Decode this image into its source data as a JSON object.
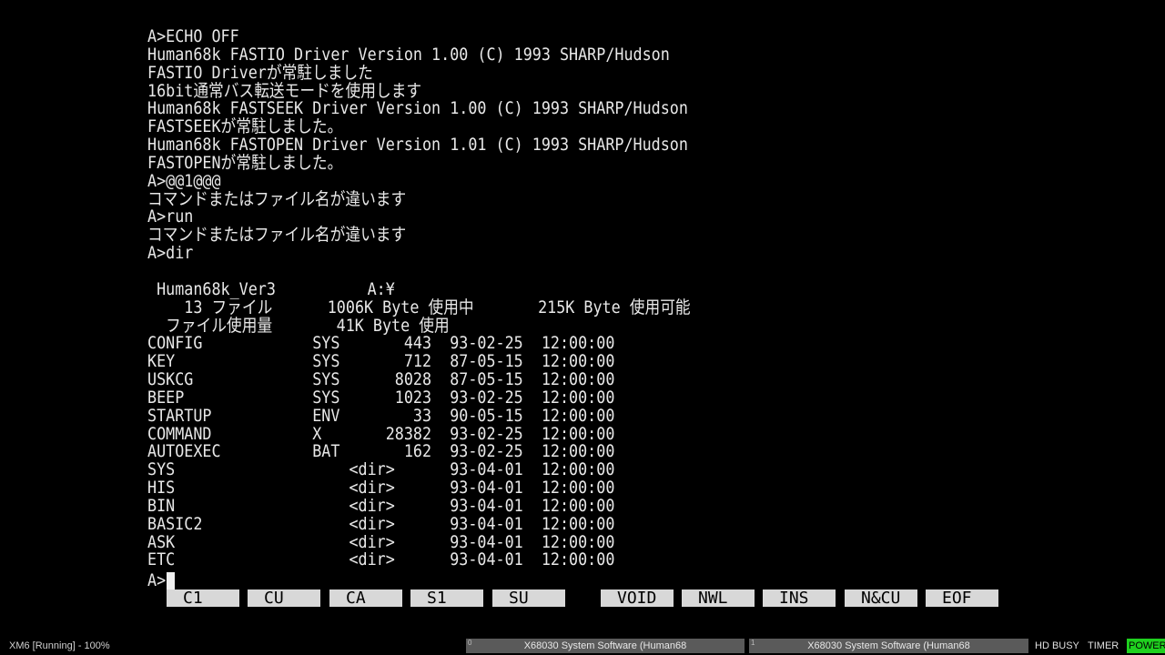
{
  "terminal": {
    "lines": [
      "A>ECHO OFF",
      "Human68k FASTIO Driver Version 1.00 (C) 1993 SHARP/Hudson",
      "FASTIO Driverが常駐しました",
      "16bit通常バス転送モードを使用します",
      "Human68k FASTSEEK Driver Version 1.00 (C) 1993 SHARP/Hudson",
      "FASTSEEKが常駐しました。",
      "Human68k FASTOPEN Driver Version 1.01 (C) 1993 SHARP/Hudson",
      "FASTOPENが常駐しました。",
      "A>@@1@@@",
      "コマンドまたはファイル名が違います",
      "A>run",
      "コマンドまたはファイル名が違います",
      "A>dir",
      "",
      " Human68k_Ver3          A:¥",
      "    13 ファイル      1006K Byte 使用中       215K Byte 使用可能",
      "  ファイル使用量       41K Byte 使用",
      "CONFIG            SYS       443  93-02-25  12:00:00",
      "KEY               SYS       712  87-05-15  12:00:00",
      "USKCG             SYS      8028  87-05-15  12:00:00",
      "BEEP              SYS      1023  93-02-25  12:00:00",
      "STARTUP           ENV        33  90-05-15  12:00:00",
      "COMMAND           X       28382  93-02-25  12:00:00",
      "AUTOEXEC          BAT       162  93-02-25  12:00:00",
      "SYS                   <dir>      93-04-01  12:00:00",
      "HIS                   <dir>      93-04-01  12:00:00",
      "BIN                   <dir>      93-04-01  12:00:00",
      "BASIC2                <dir>      93-04-01  12:00:00",
      "ASK                   <dir>      93-04-01  12:00:00",
      "ETC                   <dir>      93-04-01  12:00:00"
    ],
    "prompt": "A>"
  },
  "function_keys": [
    "C1",
    "CU",
    "CA",
    "S1",
    "SU",
    "VOID",
    "NWL",
    "INS",
    "N&CU",
    "EOF"
  ],
  "statusbar": {
    "app_status": "XM6 [Running] - 100%",
    "tab0_index": "0",
    "tab0_label": "X68030 System Software (Human68",
    "tab1_index": "1",
    "tab1_label": "X68030 System Software (Human68",
    "hd_busy": "HD BUSY",
    "timer": "TIMER",
    "power": "POWER"
  },
  "colors": {
    "power_indicator": "#1fd11f",
    "fkey_background": "#d8d8d8"
  }
}
